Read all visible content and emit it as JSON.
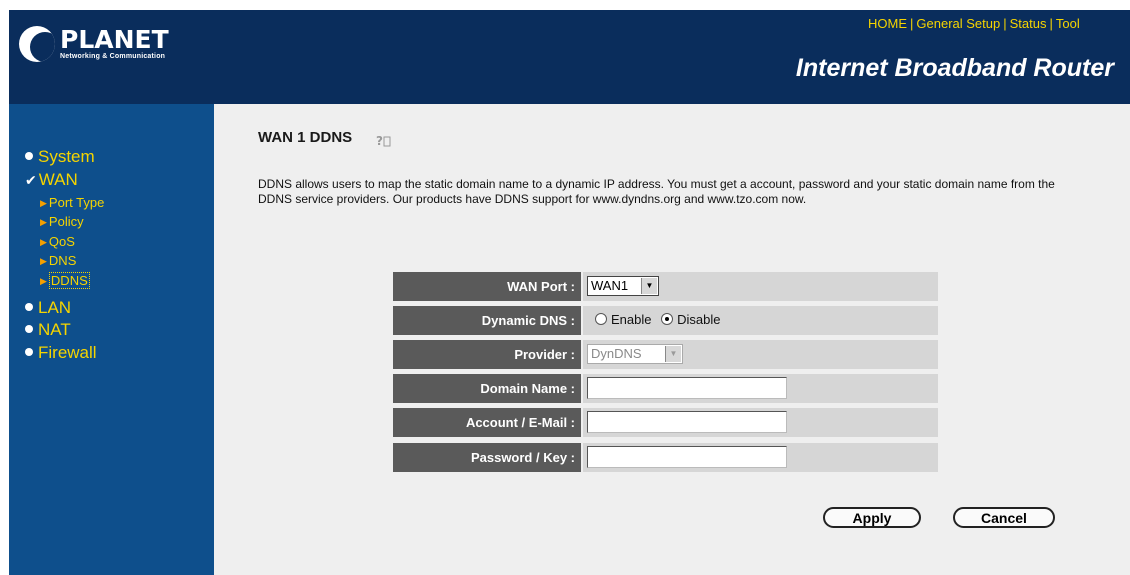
{
  "header": {
    "brand_name": "PLANET",
    "brand_tagline": "Networking & Communication",
    "product_title": "Internet Broadband Router",
    "top_nav": [
      "HOME",
      "General Setup",
      "Status",
      "Tool"
    ]
  },
  "sidebar": {
    "items": [
      {
        "label": "System"
      },
      {
        "label": "WAN"
      },
      {
        "label": "LAN"
      },
      {
        "label": "NAT"
      },
      {
        "label": "Firewall"
      }
    ],
    "wan_subitems": [
      "Port Type",
      "Policy",
      "QoS",
      "DNS",
      "DDNS"
    ]
  },
  "main": {
    "title": "WAN 1 DDNS",
    "description": "DDNS allows users to map the static domain name to a dynamic IP address. You must get a account, password and your static domain name from the DDNS service providers. Our products have DDNS support for www.dyndns.org and www.tzo.com now.",
    "form": {
      "wan_port": {
        "label": "WAN Port :",
        "value": "WAN1"
      },
      "dynamic_dns": {
        "label": "Dynamic DNS :",
        "options": [
          "Enable",
          "Disable"
        ],
        "selected": "Disable"
      },
      "provider": {
        "label": "Provider :",
        "value": "DynDNS"
      },
      "domain_name": {
        "label": "Domain Name :",
        "value": ""
      },
      "account": {
        "label": "Account / E-Mail :",
        "value": ""
      },
      "password": {
        "label": "Password / Key :",
        "value": ""
      }
    },
    "buttons": {
      "apply": "Apply",
      "cancel": "Cancel"
    }
  },
  "colors": {
    "header_bg": "#0a2d5c",
    "sidebar_bg": "#0e4f8c",
    "nav_text": "#f5d400",
    "label_bg": "#5a5a5a",
    "value_bg": "#d6d6d6",
    "main_bg": "#efefef"
  }
}
